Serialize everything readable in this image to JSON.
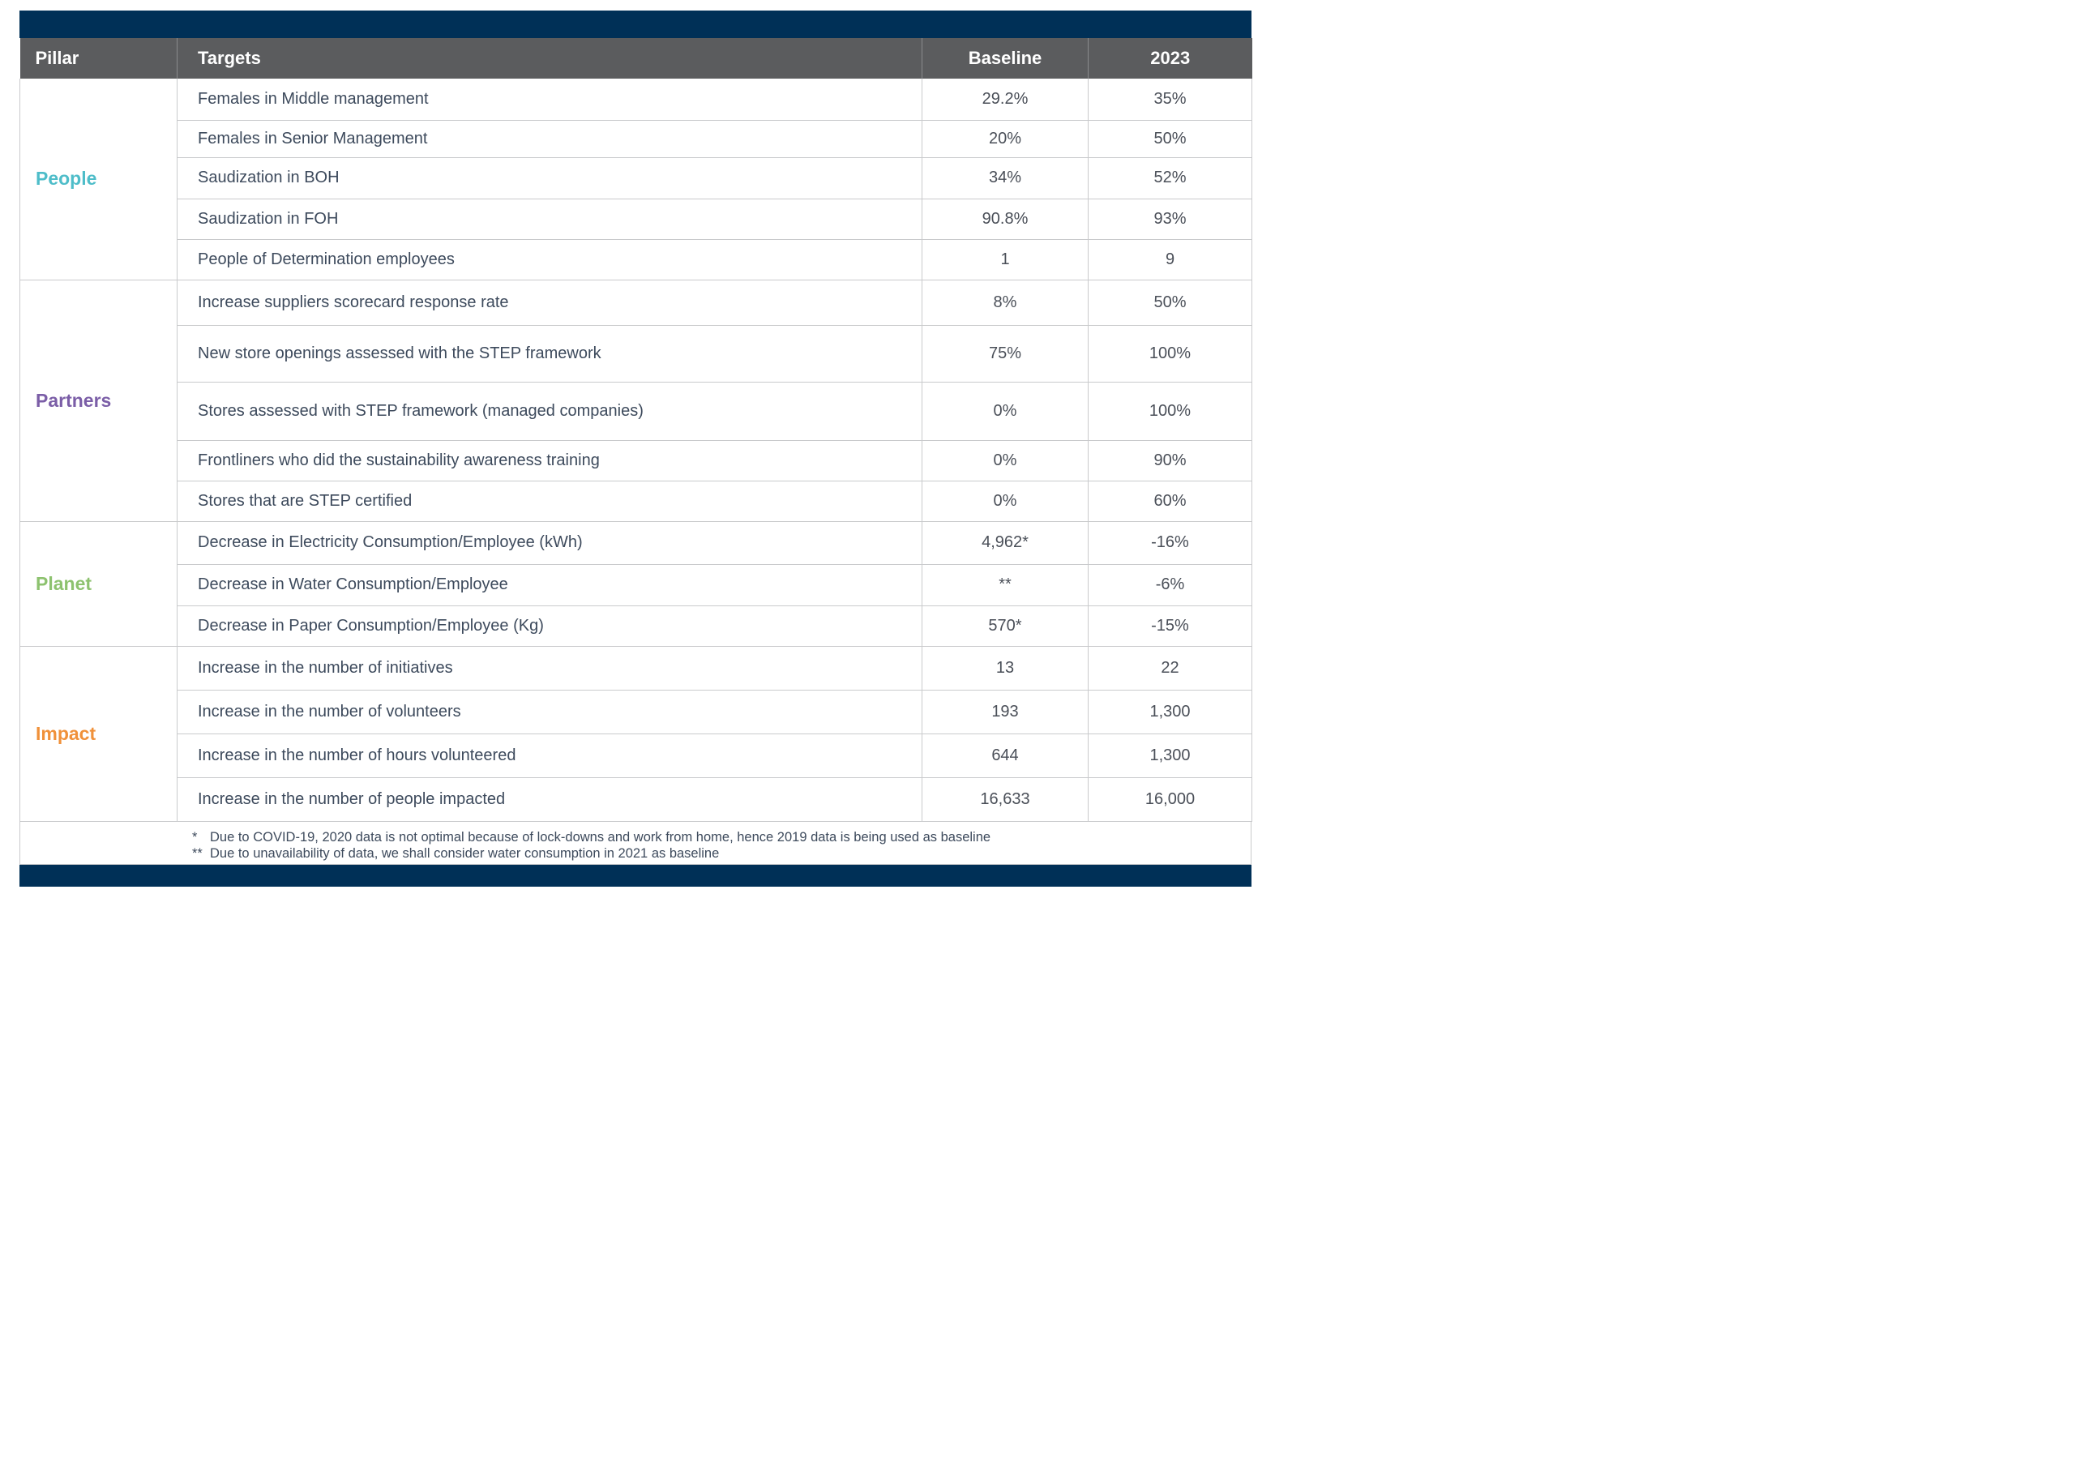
{
  "colors": {
    "header_bar": "#003057",
    "column_header_bg": "#5b5c5e",
    "people": "#4ebdc9",
    "partners": "#7b5ea7",
    "planet": "#8dc26f",
    "impact": "#f0913a"
  },
  "table": {
    "headers": {
      "pillar": "Pillar",
      "targets": "Targets",
      "baseline": "Baseline",
      "year": "2023"
    },
    "groups": [
      {
        "pillar": "People",
        "color": "#4ebdc9",
        "rows": [
          {
            "target": "Females in Middle management",
            "baseline": "29.2%",
            "year": "35%"
          },
          {
            "target": "Females in Senior Management",
            "baseline": "20%",
            "year": "50%"
          },
          {
            "target": "Saudization in BOH",
            "baseline": "34%",
            "year": "52%"
          },
          {
            "target": "Saudization in FOH",
            "baseline": "90.8%",
            "year": "93%"
          },
          {
            "target": "People of Determination employees",
            "baseline": "1",
            "year": "9"
          }
        ]
      },
      {
        "pillar": "Partners",
        "color": "#7b5ea7",
        "rows": [
          {
            "target": "Increase suppliers scorecard response rate",
            "baseline": "8%",
            "year": "50%"
          },
          {
            "target": "New store openings assessed with the STEP framework",
            "baseline": "75%",
            "year": "100%"
          },
          {
            "target": "Stores assessed with STEP framework (managed companies)",
            "baseline": "0%",
            "year": "100%"
          },
          {
            "target": "Frontliners who did the sustainability awareness training",
            "baseline": "0%",
            "year": "90%"
          },
          {
            "target": "Stores that are STEP certified",
            "baseline": "0%",
            "year": "60%"
          }
        ]
      },
      {
        "pillar": "Planet",
        "color": "#8dc26f",
        "rows": [
          {
            "target": "Decrease in Electricity Consumption/Employee (kWh)",
            "baseline": "4,962*",
            "year": "-16%"
          },
          {
            "target": "Decrease in Water Consumption/Employee",
            "baseline": "**",
            "year": "-6%"
          },
          {
            "target": "Decrease in Paper Consumption/Employee (Kg)",
            "baseline": "570*",
            "year": "-15%"
          }
        ]
      },
      {
        "pillar": "Impact",
        "color": "#f0913a",
        "rows": [
          {
            "target": "Increase in the number of initiatives",
            "baseline": "13",
            "year": "22"
          },
          {
            "target": "Increase in the number of volunteers",
            "baseline": "193",
            "year": "1,300"
          },
          {
            "target": "Increase in the number of hours volunteered",
            "baseline": "644",
            "year": "1,300"
          },
          {
            "target": "Increase in the number of people impacted",
            "baseline": "16,633",
            "year": "16,000"
          }
        ]
      }
    ]
  },
  "footnotes": [
    {
      "mark": "*",
      "text": "Due to COVID-19, 2020 data is not optimal because of lock-downs and work from home, hence 2019 data is being used as baseline"
    },
    {
      "mark": "**",
      "text": "Due to unavailability of data, we shall consider water consumption in 2021 as baseline"
    }
  ]
}
